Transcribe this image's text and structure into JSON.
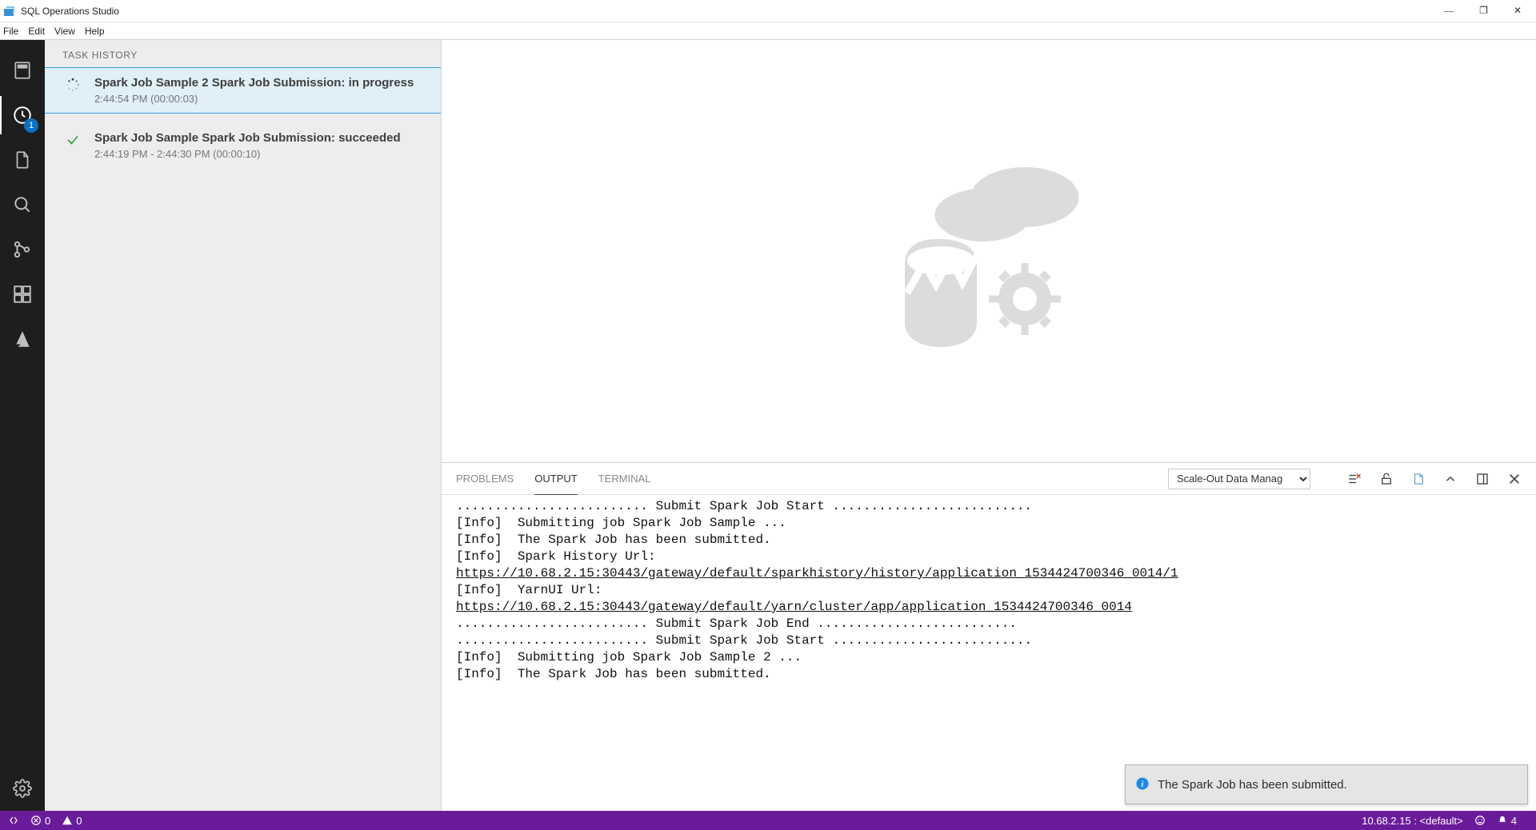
{
  "app": {
    "title": "SQL Operations Studio"
  },
  "menus": [
    "File",
    "Edit",
    "View",
    "Help"
  ],
  "activitybar": {
    "badge": "1"
  },
  "sidebar": {
    "header": "TASK HISTORY",
    "tasks": [
      {
        "status": "in-progress",
        "title": "Spark Job Sample 2 Spark Job Submission: in progress",
        "meta": "2:44:54 PM (00:00:03)"
      },
      {
        "status": "succeeded",
        "title": "Spark Job Sample Spark Job Submission: succeeded",
        "meta": "2:44:19 PM - 2:44:30 PM (00:00:10)"
      }
    ]
  },
  "panel": {
    "tabs": [
      "PROBLEMS",
      "OUTPUT",
      "TERMINAL"
    ],
    "active_tab": "OUTPUT",
    "channel": "Scale-Out Data Manag",
    "output": [
      {
        "t": "plain",
        "v": "......................... Submit Spark Job Start .........................."
      },
      {
        "t": "plain",
        "v": "[Info]  Submitting job Spark Job Sample ..."
      },
      {
        "t": "plain",
        "v": "[Info]  The Spark Job has been submitted."
      },
      {
        "t": "plain",
        "v": "[Info]  Spark History Url:"
      },
      {
        "t": "link",
        "v": "https://10.68.2.15:30443/gateway/default/sparkhistory/history/application_1534424700346_0014/1"
      },
      {
        "t": "plain",
        "v": "[Info]  YarnUI Url:"
      },
      {
        "t": "link",
        "v": "https://10.68.2.15:30443/gateway/default/yarn/cluster/app/application_1534424700346_0014"
      },
      {
        "t": "plain",
        "v": "......................... Submit Spark Job End .........................."
      },
      {
        "t": "plain",
        "v": "......................... Submit Spark Job Start .........................."
      },
      {
        "t": "plain",
        "v": "[Info]  Submitting job Spark Job Sample 2 ..."
      },
      {
        "t": "plain",
        "v": "[Info]  The Spark Job has been submitted."
      }
    ]
  },
  "toast": {
    "message": "The Spark Job has been submitted."
  },
  "statusbar": {
    "errors": "0",
    "warnings": "0",
    "connection": "10.68.2.15 : <default>",
    "notifications": "4"
  }
}
